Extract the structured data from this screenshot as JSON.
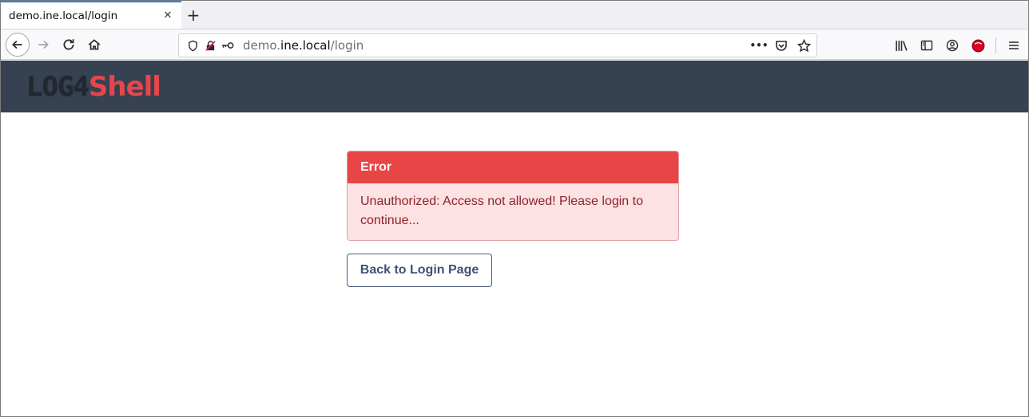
{
  "browser": {
    "tab": {
      "title": "demo.ine.local/login",
      "close": "✕"
    },
    "new_tab": "+",
    "url": {
      "prefix": "demo.",
      "host": "ine.local",
      "path": "/login"
    },
    "page_actions": "•••"
  },
  "site": {
    "logo_part1": "LOG4",
    "logo_part2": "Shell"
  },
  "alert": {
    "title": "Error",
    "message": "Unauthorized: Access not allowed! Please login to continue..."
  },
  "back_button": {
    "label": "Back to Login Page"
  },
  "colors": {
    "header_bg": "#364152",
    "alert_header": "#e84546",
    "alert_body": "#fde2e4",
    "button_text": "#3f5273"
  }
}
